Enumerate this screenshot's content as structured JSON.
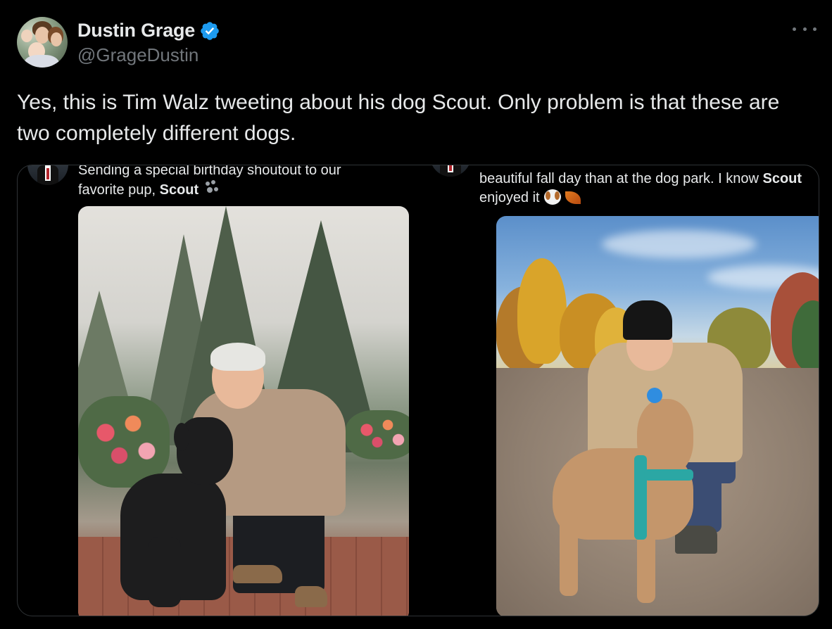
{
  "author": {
    "display_name": "Dustin Grage",
    "handle": "@GrageDustin",
    "verified": true,
    "verified_color": "#1d9bf0"
  },
  "tweet": {
    "text": "Yes, this is Tim Walz tweeting about his dog Scout. Only problem is that these are two completely different dogs."
  },
  "media": {
    "left": {
      "caption_pre": "Sending a special birthday shoutout to our favorite pup, ",
      "caption_bold": "Scout",
      "emoji": "paw-prints-icon"
    },
    "right": {
      "caption_pre": "beautiful fall day than at the dog park. I know ",
      "caption_bold": "Scout",
      "caption_post": " enjoyed it",
      "emoji": [
        "dog-face-icon",
        "fallen-leaf-icon"
      ]
    }
  },
  "colors": {
    "background": "#000000",
    "text": "#e7e9ea",
    "secondary_text": "#71767b",
    "border": "#2f3336"
  }
}
